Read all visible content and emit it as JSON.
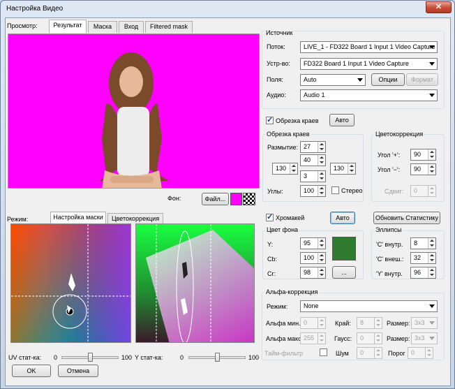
{
  "window": {
    "title": "Настройка Видео",
    "close": "✕"
  },
  "preview": {
    "label": "Просмотр:",
    "tabs": [
      "Результат",
      "Маска",
      "Вход",
      "Filtered mask"
    ],
    "background_label": "Фон:",
    "file_button": "Файл...",
    "bg_color": "#ff00ff"
  },
  "mode": {
    "label": "Режим:",
    "tabs": [
      "Настройка маски",
      "Цветокоррекция"
    ],
    "uv_label": "UV стат-ка:",
    "uv_min": "0",
    "uv_max": "100",
    "y_label": "Y стат-ка:",
    "y_min": "0",
    "y_max": "100",
    "uv_value": 0.5,
    "y_value": 0.5
  },
  "buttons": {
    "ok": "OK",
    "cancel": "Отмена"
  },
  "source": {
    "title": "Источник",
    "stream_label": "Поток:",
    "stream_value": "LIVE_1 - FD322 Board 1 Input 1 Video Capture",
    "device_label": "Устр-во:",
    "device_value": "FD322 Board 1 Input 1 Video Capture",
    "fields_label": "Поля:",
    "fields_value": "Auto",
    "options_button": "Опции",
    "format_button": "Формат",
    "audio_label": "Аудио:",
    "audio_value": "Audio 1"
  },
  "crop": {
    "check_label": "Обрезка краев",
    "auto_button": "Авто",
    "group_title": "Обрезка краев",
    "blur_label": "Размытие:",
    "blur": "27",
    "top": "40",
    "left": "130",
    "bottom": "3",
    "right": "130",
    "corners_label": "Углы:",
    "corners": "100",
    "stereo_label": "Стерео"
  },
  "color_correction": {
    "title": "Цветокоррекция",
    "angle_plus_label": "Угол '+':",
    "angle_plus": "90",
    "angle_minus_label": "Угол '−':",
    "angle_minus": "90",
    "shift_label": "Сдвиг:",
    "shift": "0"
  },
  "chromakey": {
    "check_label": "Хромакей",
    "auto_button": "Авто",
    "update_stats_button": "Обновить Статистику",
    "bg_color_title": "Цвет фона",
    "y_label": "Y:",
    "y": "95",
    "cb_label": "Cb:",
    "cb": "100",
    "cr_label": "Cr:",
    "cr": "98",
    "more_button": "...",
    "swatch_color": "#2e7a2e"
  },
  "ellipses": {
    "title": "Эллипсы",
    "c_inner_label": "'C' внутр.",
    "c_inner": "8",
    "c_outer_label": "'C' внеш.:",
    "c_outer": "32",
    "y_inner_label": "'Y' внутр.",
    "y_inner": "96"
  },
  "alpha": {
    "title": "Альфа-коррекция",
    "mode_label": "Режим:",
    "mode_value": "None",
    "alpha_min_label": "Альфа мин.:",
    "alpha_min": "0",
    "edge_label": "Край:",
    "edge": "8",
    "size_label": "Размер:",
    "size1": "3x3",
    "alpha_max_label": "Альфа макс.",
    "alpha_max": "255",
    "gauss_label": "Гаусс:",
    "gauss": "0",
    "size2": "3x3",
    "time_filter_label": "Тайм-фильтр",
    "noise_label": "Шум",
    "noise": "0",
    "threshold_label": "Порог",
    "threshold": "0"
  }
}
